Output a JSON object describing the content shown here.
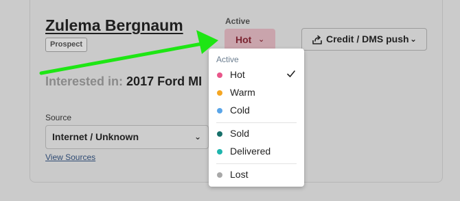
{
  "lead": {
    "name": "Zulema Bergnaum",
    "badge": "Prospect",
    "interested_label": "Interested in:",
    "interested_value": "2017 Ford MI"
  },
  "source": {
    "label": "Source",
    "value": "Internet / Unknown",
    "link": "View Sources"
  },
  "status": {
    "label": "Active",
    "selected": "Hot"
  },
  "credit_button": {
    "label": "Credit / DMS push"
  },
  "menu": {
    "header": "Active",
    "options": [
      {
        "label": "Hot",
        "color": "#e8568a",
        "checked": true
      },
      {
        "label": "Warm",
        "color": "#f5a623"
      },
      {
        "label": "Cold",
        "color": "#5aa5e8"
      },
      {
        "label": "Sold",
        "color": "#17706a"
      },
      {
        "label": "Delivered",
        "color": "#1fb5ad"
      },
      {
        "label": "Lost",
        "color": "#a8a8a8"
      }
    ]
  },
  "colors": {
    "accent_arrow": "#1ee614",
    "status_button_bg": "#c9a4ac"
  },
  "icons": [
    "share-upload-icon",
    "chevron-down-icon",
    "check-icon"
  ]
}
